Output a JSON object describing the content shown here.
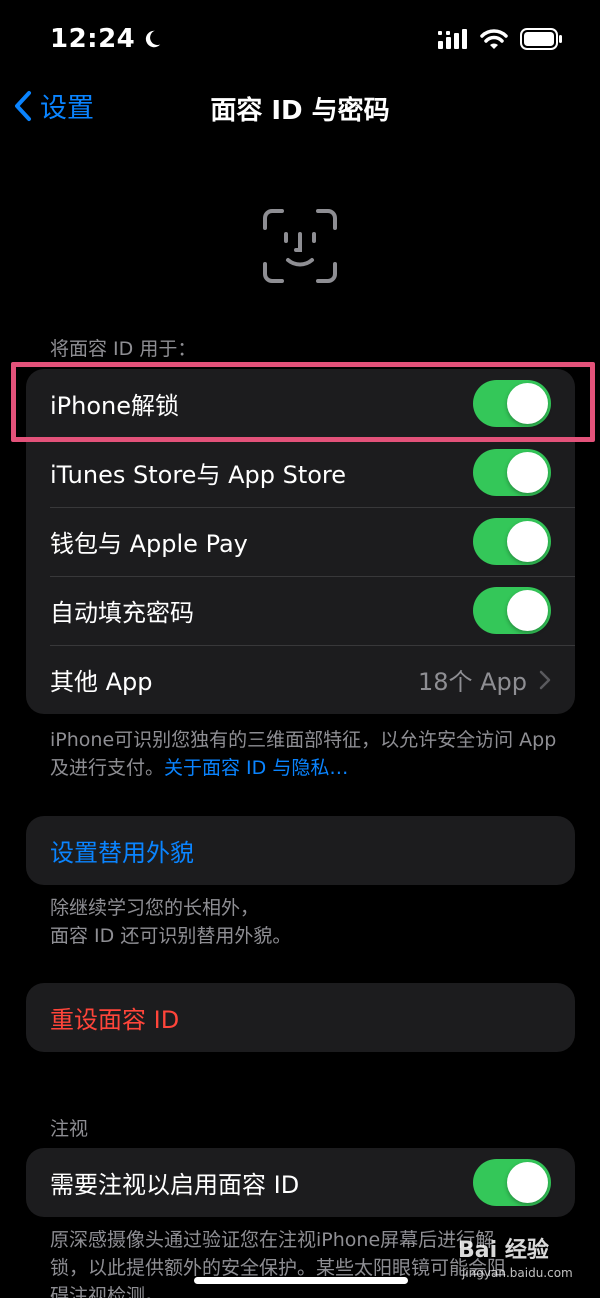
{
  "status_bar": {
    "time": "12:24",
    "icons": [
      "moon-icon",
      "cellular-signal-icon",
      "wifi-icon",
      "battery-icon"
    ]
  },
  "nav": {
    "back_label": "设置",
    "title": "面容 ID 与密码"
  },
  "use_for": {
    "header": "将面容 ID 用于：",
    "rows": [
      {
        "label": "iPhone解锁",
        "on": true
      },
      {
        "label": "iTunes Store与 App Store",
        "on": true
      },
      {
        "label": "钱包与 Apple Pay",
        "on": true
      },
      {
        "label": "自动填充密码",
        "on": true
      }
    ],
    "other_app": {
      "label": "其他 App",
      "value": "18个 App"
    },
    "footer_text": "iPhone可识别您独有的三维面部特征，以允许安全访问 App及进行支付。",
    "footer_link": "关于面容 ID 与隐私…"
  },
  "alternate": {
    "label": "设置替用外貌",
    "footer_line1": "除继续学习您的长相外，",
    "footer_line2": "面容 ID 还可识别替用外貌。"
  },
  "reset": {
    "label": "重设面容 ID"
  },
  "attention": {
    "header": "注视",
    "row_label": "需要注视以启用面容 ID",
    "on": true,
    "footer_line1": "原深感摄像头通过验证您在注视iPhone屏幕后进行解",
    "footer_line2": "锁，以此提供额外的安全保护。某些太阳眼镜可能会阻",
    "footer_line3": "碍注视检测。"
  },
  "watermark": {
    "text": "Bai 经验",
    "sub": "jingyan.baidu.com"
  },
  "colors": {
    "background": "#000000",
    "cell": "#1c1c1e",
    "accent_blue": "#0a84ff",
    "toggle_green": "#34c759",
    "destructive_red": "#ff453a",
    "highlight_pink": "#e3527a",
    "secondary_text": "#8e8e93"
  }
}
